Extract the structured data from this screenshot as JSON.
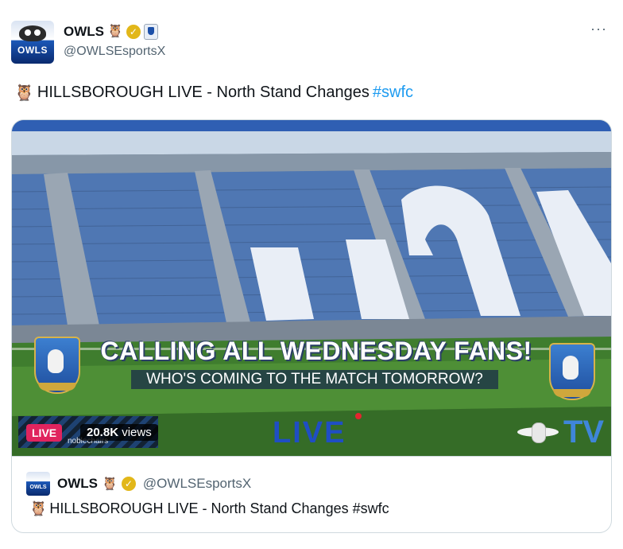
{
  "author": {
    "display_name": "OWLS",
    "name_emoji": "🦉",
    "handle": "@OWLSEsportsX",
    "avatar_text": "OWLS",
    "verified_icon": "verified-badge-icon",
    "affiliate_icon": "club-crest-affiliate-icon"
  },
  "more_label": "···",
  "post": {
    "emoji": "🦉",
    "text": "HILLSBOROUGH LIVE - North Stand Changes",
    "hashtag": "#swfc"
  },
  "media": {
    "headline": "CALLING ALL WEDNESDAY FANS!",
    "subline": "WHO'S COMING TO THE MATCH TOMORROW?",
    "live_logo": "LIVE",
    "tv_logo": "TV",
    "sponsor": "noblechairs",
    "live_badge": "LIVE",
    "views_count": "20.8K",
    "views_label": "views"
  },
  "quote": {
    "display_name": "OWLS",
    "name_emoji": "🦉",
    "handle": "@OWLSEsportsX",
    "avatar_text": "OWLS",
    "emoji": "🦉",
    "text": "HILLSBOROUGH LIVE - North Stand Changes #swfc"
  },
  "colors": {
    "hashtag": "#1d9bf0",
    "live_badge": "#e0245e",
    "verified": "#e2b719",
    "seat_blue": "#3b7dd8"
  }
}
